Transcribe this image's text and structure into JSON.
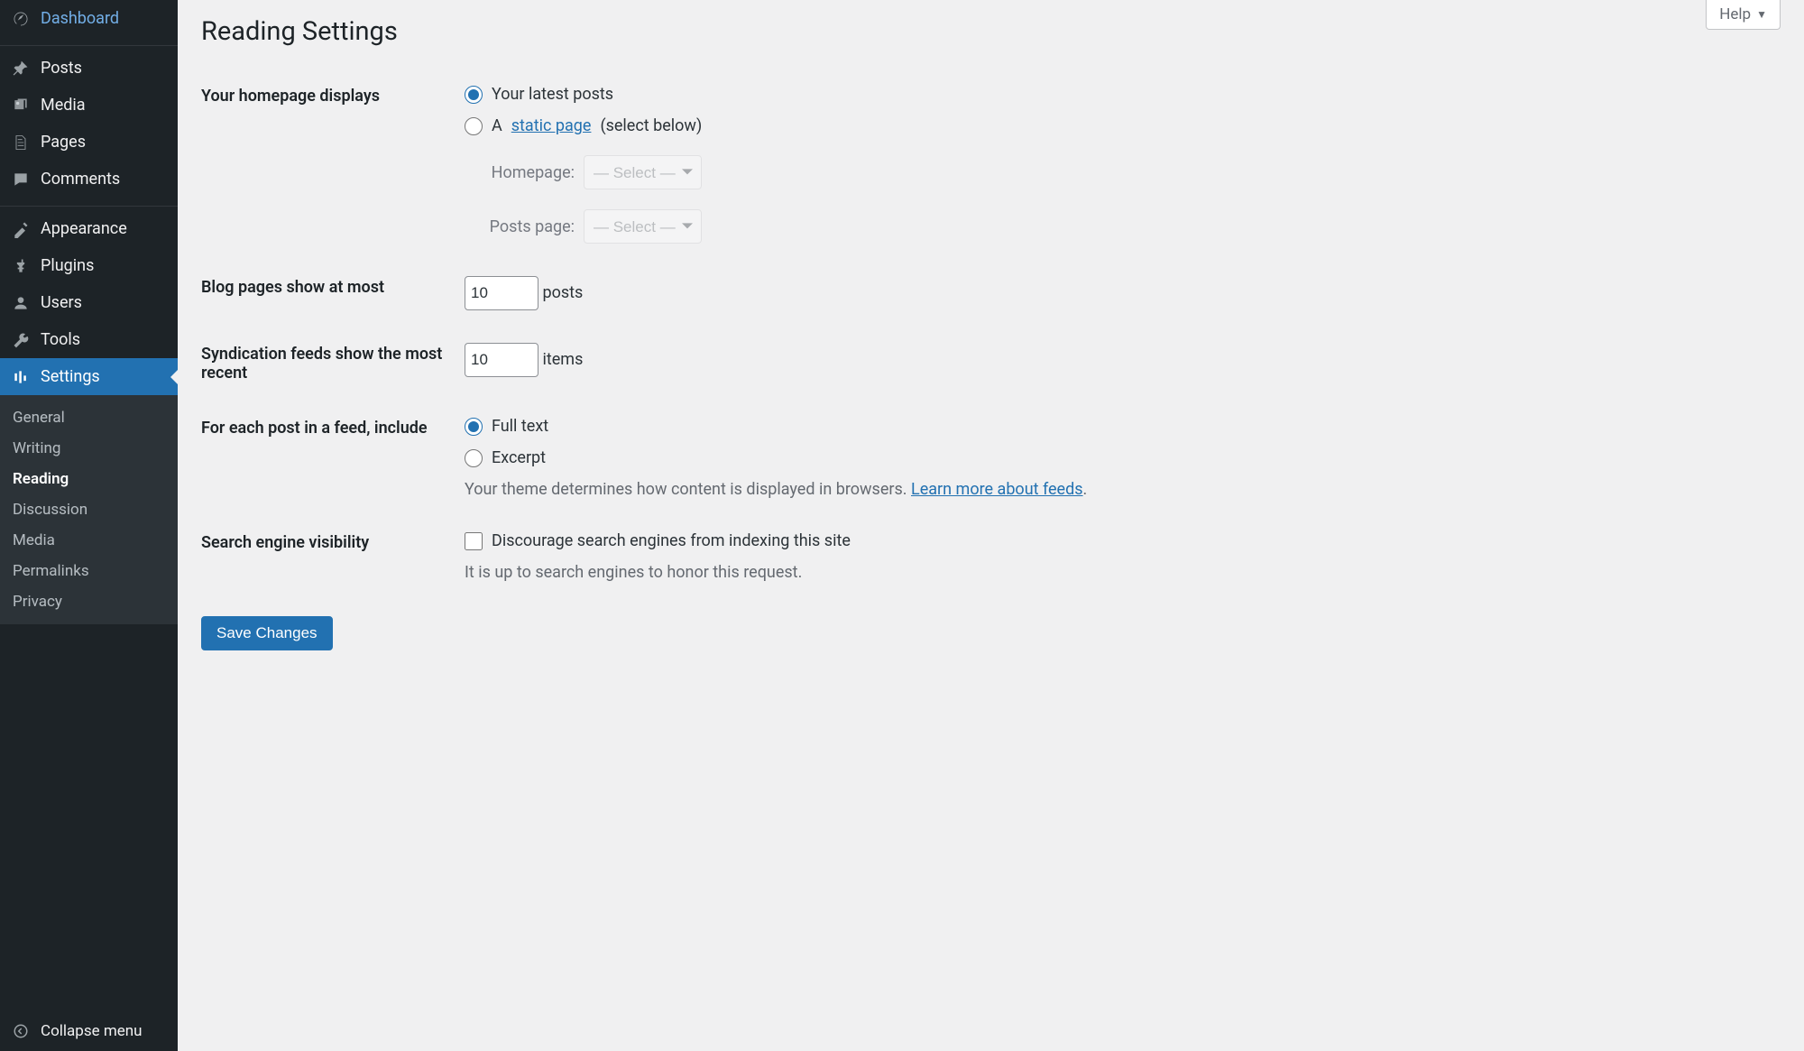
{
  "sidebar": {
    "items": [
      {
        "label": "Dashboard",
        "name": "dashboard"
      },
      {
        "label": "Posts",
        "name": "posts"
      },
      {
        "label": "Media",
        "name": "media"
      },
      {
        "label": "Pages",
        "name": "pages"
      },
      {
        "label": "Comments",
        "name": "comments"
      },
      {
        "label": "Appearance",
        "name": "appearance"
      },
      {
        "label": "Plugins",
        "name": "plugins"
      },
      {
        "label": "Users",
        "name": "users"
      },
      {
        "label": "Tools",
        "name": "tools"
      },
      {
        "label": "Settings",
        "name": "settings"
      }
    ],
    "submenu": [
      {
        "label": "General",
        "name": "general"
      },
      {
        "label": "Writing",
        "name": "writing"
      },
      {
        "label": "Reading",
        "name": "reading",
        "current": true
      },
      {
        "label": "Discussion",
        "name": "discussion"
      },
      {
        "label": "Media",
        "name": "media-settings"
      },
      {
        "label": "Permalinks",
        "name": "permalinks"
      },
      {
        "label": "Privacy",
        "name": "privacy"
      }
    ],
    "collapse_label": "Collapse menu"
  },
  "header": {
    "title": "Reading Settings",
    "help_label": "Help"
  },
  "form": {
    "homepage_displays": {
      "label": "Your homepage displays",
      "opt_latest": "Your latest posts",
      "opt_static_prefix": "A ",
      "opt_static_link": "static page",
      "opt_static_suffix": " (select below)",
      "homepage_label": "Homepage:",
      "posts_page_label": "Posts page:",
      "select_placeholder": "— Select —"
    },
    "blog_pages": {
      "label": "Blog pages show at most",
      "value": "10",
      "suffix": "posts"
    },
    "syndication": {
      "label": "Syndication feeds show the most recent",
      "value": "10",
      "suffix": "items"
    },
    "feed_include": {
      "label": "For each post in a feed, include",
      "opt_full": "Full text",
      "opt_excerpt": "Excerpt",
      "desc_prefix": "Your theme determines how content is displayed in browsers. ",
      "desc_link": "Learn more about feeds",
      "desc_suffix": "."
    },
    "search_visibility": {
      "label": "Search engine visibility",
      "checkbox_label": "Discourage search engines from indexing this site",
      "desc": "It is up to search engines to honor this request."
    },
    "submit_label": "Save Changes"
  }
}
